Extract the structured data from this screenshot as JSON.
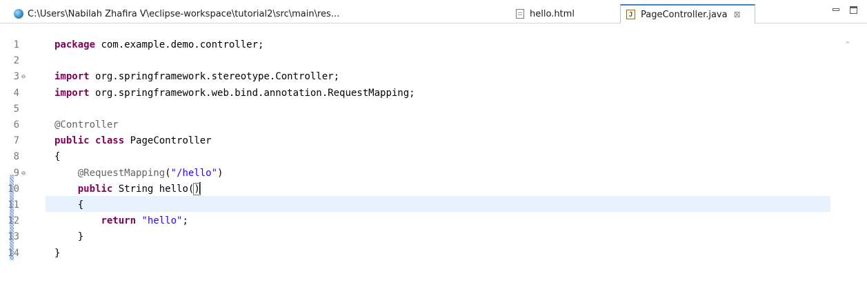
{
  "tabs": [
    {
      "label": "C:\\Users\\Nabilah Zhafira V\\eclipse-workspace\\tutorial2\\src\\main\\res...",
      "icon": "globe-icon",
      "active": false
    },
    {
      "label": "hello.html",
      "icon": "html-file-icon",
      "active": false
    },
    {
      "label": "PageController.java",
      "icon": "java-file-icon",
      "active": true,
      "close": "⊠"
    }
  ],
  "window_controls": {
    "minimize_icon": "minimize-icon",
    "maximize_icon": "maximize-icon"
  },
  "colors": {
    "keyword": "#7f0055",
    "string": "#2a00ff",
    "annotation": "#646464",
    "current_line": "#e8f2fe",
    "active_tab_accent": "#3c83c5"
  },
  "editor": {
    "lines": [
      {
        "num": "1",
        "segs": [
          [
            "kw",
            "package"
          ],
          [
            "t",
            " com.example.demo.controller;"
          ]
        ]
      },
      {
        "num": "2",
        "segs": []
      },
      {
        "num": "3",
        "fold": "⊖",
        "segs": [
          [
            "kw",
            "import"
          ],
          [
            "t",
            " org.springframework.stereotype.Controller;"
          ]
        ]
      },
      {
        "num": "4",
        "segs": [
          [
            "kw",
            "import"
          ],
          [
            "t",
            " org.springframework.web.bind.annotation.RequestMapping;"
          ]
        ]
      },
      {
        "num": "5",
        "segs": []
      },
      {
        "num": "6",
        "segs": [
          [
            "ann",
            "@Controller"
          ]
        ]
      },
      {
        "num": "7",
        "segs": [
          [
            "kw",
            "public"
          ],
          [
            "t",
            " "
          ],
          [
            "kw",
            "class"
          ],
          [
            "t",
            " PageController"
          ]
        ]
      },
      {
        "num": "8",
        "segs": [
          [
            "t",
            "{"
          ]
        ]
      },
      {
        "num": "9",
        "fold": "⊖",
        "segs": [
          [
            "t",
            "    "
          ],
          [
            "ann",
            "@RequestMapping"
          ],
          [
            "t",
            "("
          ],
          [
            "str",
            "\"/hello\""
          ],
          [
            "t",
            ")"
          ]
        ]
      },
      {
        "num": "10",
        "current": true,
        "segs": [
          [
            "t",
            "    "
          ],
          [
            "kw",
            "public"
          ],
          [
            "t",
            " String hello("
          ],
          [
            "brack",
            ")"
          ]
        ]
      },
      {
        "num": "11",
        "segs": [
          [
            "t",
            "    {"
          ]
        ]
      },
      {
        "num": "12",
        "segs": [
          [
            "t",
            "        "
          ],
          [
            "kw",
            "return"
          ],
          [
            "t",
            " "
          ],
          [
            "str",
            "\"hello\""
          ],
          [
            "t",
            ";"
          ]
        ]
      },
      {
        "num": "13",
        "segs": [
          [
            "t",
            "    }"
          ]
        ]
      },
      {
        "num": "14",
        "segs": [
          [
            "t",
            "}"
          ]
        ]
      }
    ]
  }
}
